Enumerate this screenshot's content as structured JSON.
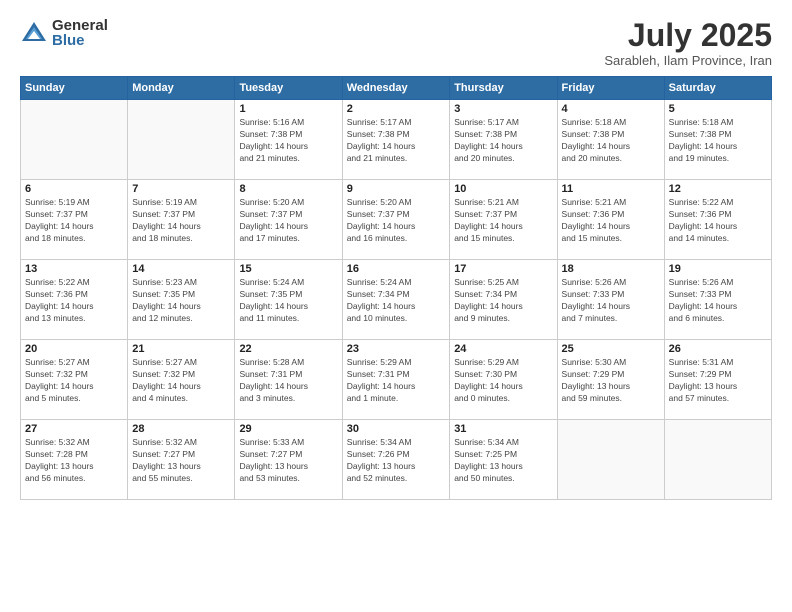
{
  "header": {
    "logo_general": "General",
    "logo_blue": "Blue",
    "month_year": "July 2025",
    "location": "Sarableh, Ilam Province, Iran"
  },
  "weekdays": [
    "Sunday",
    "Monday",
    "Tuesday",
    "Wednesday",
    "Thursday",
    "Friday",
    "Saturday"
  ],
  "weeks": [
    [
      {
        "day": "",
        "info": ""
      },
      {
        "day": "",
        "info": ""
      },
      {
        "day": "1",
        "info": "Sunrise: 5:16 AM\nSunset: 7:38 PM\nDaylight: 14 hours\nand 21 minutes."
      },
      {
        "day": "2",
        "info": "Sunrise: 5:17 AM\nSunset: 7:38 PM\nDaylight: 14 hours\nand 21 minutes."
      },
      {
        "day": "3",
        "info": "Sunrise: 5:17 AM\nSunset: 7:38 PM\nDaylight: 14 hours\nand 20 minutes."
      },
      {
        "day": "4",
        "info": "Sunrise: 5:18 AM\nSunset: 7:38 PM\nDaylight: 14 hours\nand 20 minutes."
      },
      {
        "day": "5",
        "info": "Sunrise: 5:18 AM\nSunset: 7:38 PM\nDaylight: 14 hours\nand 19 minutes."
      }
    ],
    [
      {
        "day": "6",
        "info": "Sunrise: 5:19 AM\nSunset: 7:37 PM\nDaylight: 14 hours\nand 18 minutes."
      },
      {
        "day": "7",
        "info": "Sunrise: 5:19 AM\nSunset: 7:37 PM\nDaylight: 14 hours\nand 18 minutes."
      },
      {
        "day": "8",
        "info": "Sunrise: 5:20 AM\nSunset: 7:37 PM\nDaylight: 14 hours\nand 17 minutes."
      },
      {
        "day": "9",
        "info": "Sunrise: 5:20 AM\nSunset: 7:37 PM\nDaylight: 14 hours\nand 16 minutes."
      },
      {
        "day": "10",
        "info": "Sunrise: 5:21 AM\nSunset: 7:37 PM\nDaylight: 14 hours\nand 15 minutes."
      },
      {
        "day": "11",
        "info": "Sunrise: 5:21 AM\nSunset: 7:36 PM\nDaylight: 14 hours\nand 15 minutes."
      },
      {
        "day": "12",
        "info": "Sunrise: 5:22 AM\nSunset: 7:36 PM\nDaylight: 14 hours\nand 14 minutes."
      }
    ],
    [
      {
        "day": "13",
        "info": "Sunrise: 5:22 AM\nSunset: 7:36 PM\nDaylight: 14 hours\nand 13 minutes."
      },
      {
        "day": "14",
        "info": "Sunrise: 5:23 AM\nSunset: 7:35 PM\nDaylight: 14 hours\nand 12 minutes."
      },
      {
        "day": "15",
        "info": "Sunrise: 5:24 AM\nSunset: 7:35 PM\nDaylight: 14 hours\nand 11 minutes."
      },
      {
        "day": "16",
        "info": "Sunrise: 5:24 AM\nSunset: 7:34 PM\nDaylight: 14 hours\nand 10 minutes."
      },
      {
        "day": "17",
        "info": "Sunrise: 5:25 AM\nSunset: 7:34 PM\nDaylight: 14 hours\nand 9 minutes."
      },
      {
        "day": "18",
        "info": "Sunrise: 5:26 AM\nSunset: 7:33 PM\nDaylight: 14 hours\nand 7 minutes."
      },
      {
        "day": "19",
        "info": "Sunrise: 5:26 AM\nSunset: 7:33 PM\nDaylight: 14 hours\nand 6 minutes."
      }
    ],
    [
      {
        "day": "20",
        "info": "Sunrise: 5:27 AM\nSunset: 7:32 PM\nDaylight: 14 hours\nand 5 minutes."
      },
      {
        "day": "21",
        "info": "Sunrise: 5:27 AM\nSunset: 7:32 PM\nDaylight: 14 hours\nand 4 minutes."
      },
      {
        "day": "22",
        "info": "Sunrise: 5:28 AM\nSunset: 7:31 PM\nDaylight: 14 hours\nand 3 minutes."
      },
      {
        "day": "23",
        "info": "Sunrise: 5:29 AM\nSunset: 7:31 PM\nDaylight: 14 hours\nand 1 minute."
      },
      {
        "day": "24",
        "info": "Sunrise: 5:29 AM\nSunset: 7:30 PM\nDaylight: 14 hours\nand 0 minutes."
      },
      {
        "day": "25",
        "info": "Sunrise: 5:30 AM\nSunset: 7:29 PM\nDaylight: 13 hours\nand 59 minutes."
      },
      {
        "day": "26",
        "info": "Sunrise: 5:31 AM\nSunset: 7:29 PM\nDaylight: 13 hours\nand 57 minutes."
      }
    ],
    [
      {
        "day": "27",
        "info": "Sunrise: 5:32 AM\nSunset: 7:28 PM\nDaylight: 13 hours\nand 56 minutes."
      },
      {
        "day": "28",
        "info": "Sunrise: 5:32 AM\nSunset: 7:27 PM\nDaylight: 13 hours\nand 55 minutes."
      },
      {
        "day": "29",
        "info": "Sunrise: 5:33 AM\nSunset: 7:27 PM\nDaylight: 13 hours\nand 53 minutes."
      },
      {
        "day": "30",
        "info": "Sunrise: 5:34 AM\nSunset: 7:26 PM\nDaylight: 13 hours\nand 52 minutes."
      },
      {
        "day": "31",
        "info": "Sunrise: 5:34 AM\nSunset: 7:25 PM\nDaylight: 13 hours\nand 50 minutes."
      },
      {
        "day": "",
        "info": ""
      },
      {
        "day": "",
        "info": ""
      }
    ]
  ]
}
